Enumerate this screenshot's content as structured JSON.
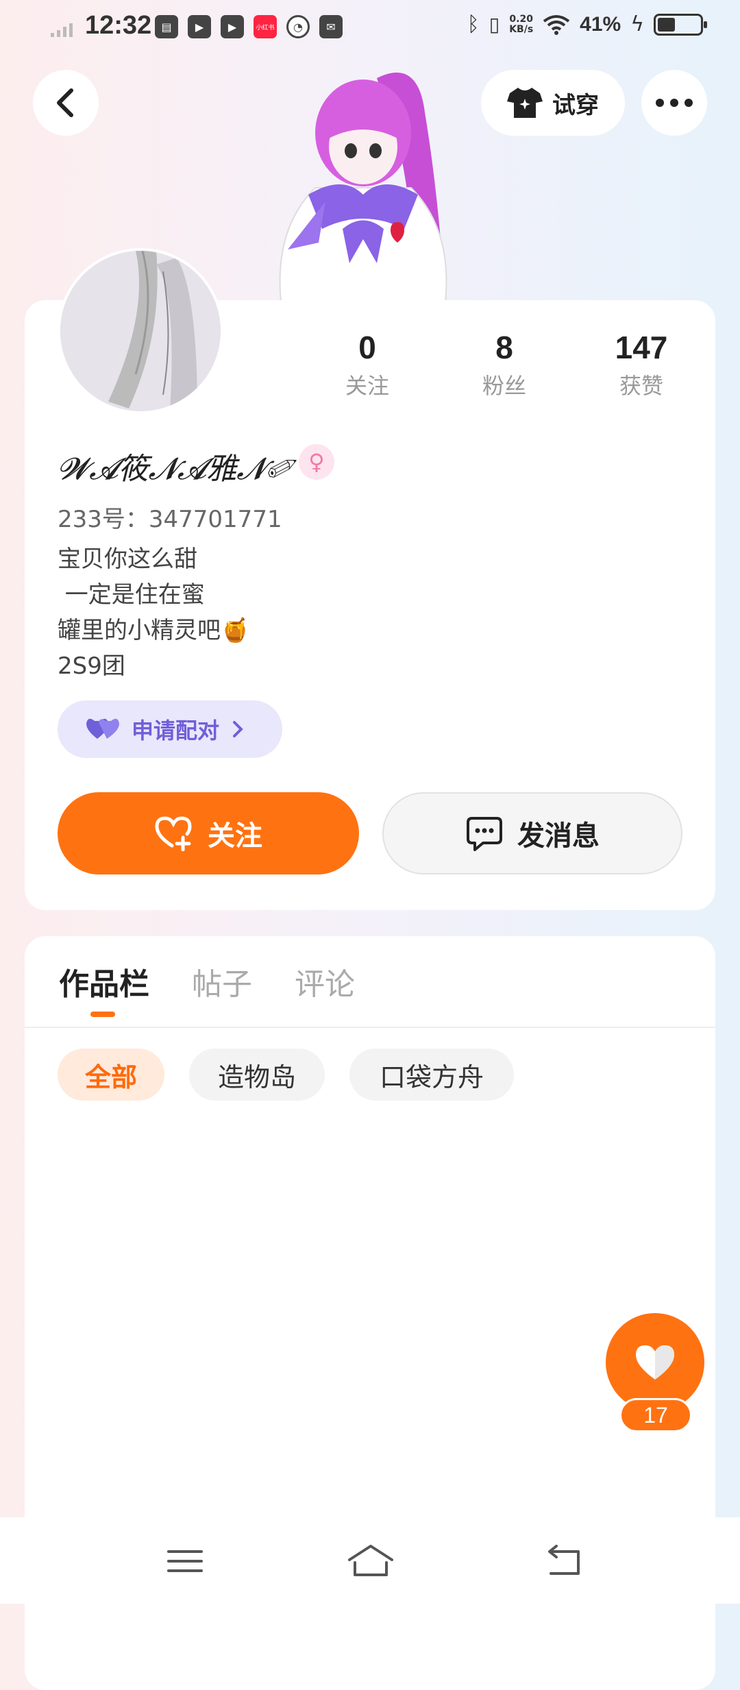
{
  "status_bar": {
    "time": "12:32",
    "net_speed_value": "0.20",
    "net_speed_unit": "KB/s",
    "battery_percent": "41%",
    "battery_level": 0.41,
    "notification_icons": [
      "sim-card-icon",
      "video-app-icon",
      "video-app-icon",
      "red-app-icon",
      "speedometer-icon",
      "mail-icon"
    ],
    "red_app_label": "小红书"
  },
  "header": {
    "back_icon": "chevron-left-icon",
    "try_on_label": "试穿",
    "try_on_icon": "tshirt-icon",
    "more_icon": "more-dots-icon"
  },
  "profile": {
    "stats": [
      {
        "value": "0",
        "label": "关注"
      },
      {
        "value": "8",
        "label": "粉丝"
      },
      {
        "value": "147",
        "label": "获赞"
      }
    ],
    "username": "𝓦𝓐筱𝓝𝓐雅𝓝✐",
    "gender_symbol": "♀",
    "uid": "233号：347701771",
    "bio": "宝贝你这么甜\n 一定是住在蜜\n罐里的小精灵吧🍯\n2S9团",
    "pair_label": "申请配对",
    "follow_label": "关注",
    "message_label": "发消息"
  },
  "content": {
    "tabs": [
      "作品栏",
      "帖子",
      "评论"
    ],
    "active_tab": 0,
    "chips": [
      "全部",
      "造物岛",
      "口袋方舟"
    ],
    "active_chip": 0
  },
  "floating": {
    "like_count": "17"
  },
  "colors": {
    "accent": "#ff7211",
    "pair_text": "#6f5fd9",
    "pair_bg": "#e9e7fb"
  }
}
